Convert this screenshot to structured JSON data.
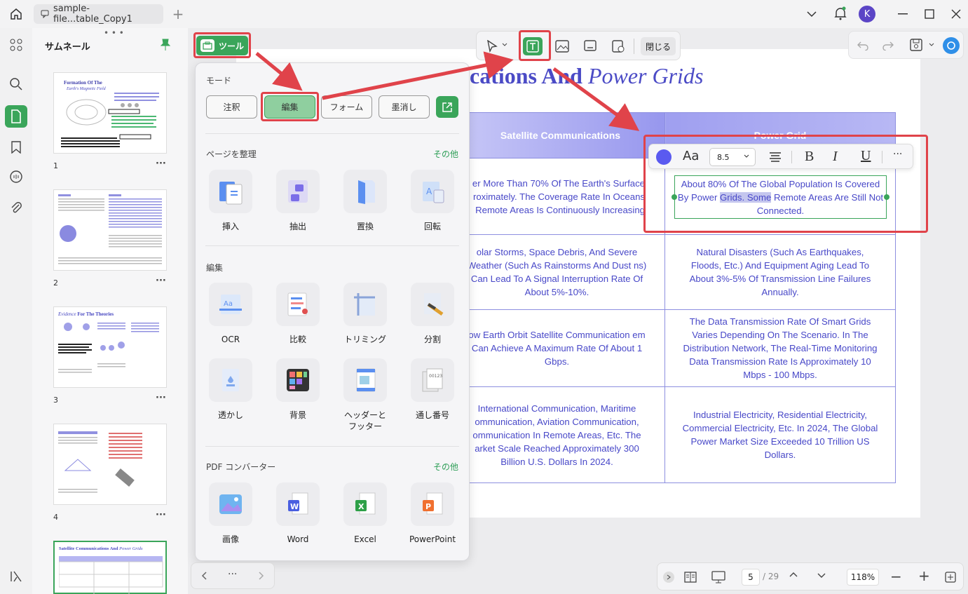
{
  "window": {
    "tab_label": "sample-file...table_Copy1",
    "user_initial": "K"
  },
  "thumbnails": {
    "title": "サムネール",
    "pages": [
      {
        "num": "1",
        "title_plain": "Formation Of The",
        "title_em": "Earth's Magnetic Field"
      },
      {
        "num": "2"
      },
      {
        "num": "3",
        "title_em": "Evidence",
        "title_plain": "For The Theories"
      },
      {
        "num": "4"
      },
      {
        "num": "5",
        "title_plain": "Satellite Communications And",
        "title_em": "Power Grids"
      }
    ]
  },
  "tools_button": {
    "label": "ツール"
  },
  "toolbar": {
    "close_label": "閉じる"
  },
  "document": {
    "heading_plain": "cations And ",
    "heading_em": "Power Grids",
    "col1_header": "Satellite Communications",
    "col2_header": "Power Grid",
    "rows": [
      {
        "left": "er More Than 70% Of The Earth's Surface roximately. The Coverage Rate In Oceans Remote Areas Is Continuously Increasing",
        "right_a": "About 80% Of The Global Population Is Covered By Power ",
        "right_sel": "Grids. Some",
        "right_b": " Remote Areas Are Still Not Connected."
      },
      {
        "left": "olar Storms, Space Debris, And Severe Weather (Such As Rainstorms And Dust ns) Can Lead To A Signal Interruption Rate Of About 5%-10%.",
        "right": "Natural Disasters (Such As Earthquakes, Floods, Etc.) And Equipment Aging Lead To About 3%-5% Of Transmission Line Failures Annually."
      },
      {
        "left": "ow Earth Orbit Satellite Communication em Can Achieve A Maximum Rate Of About 1 Gbps.",
        "right": "The Data Transmission Rate Of Smart Grids Varies Depending On The Scenario. In The Distribution Network, The Real-Time Monitoring Data Transmission Rate Is Approximately 10 Mbps - 100 Mbps."
      },
      {
        "left": "International Communication, Maritime ommunication, Aviation Communication, ommunication In Remote Areas, Etc. The arket Scale Reached Approximately 300 Billion U.S. Dollars In 2024.",
        "right": "Industrial Electricity, Residential Electricity, Commercial Electricity, Etc. In 2024, The Global Power Market Size Exceeded 10 Trillion US Dollars."
      }
    ]
  },
  "format_bar": {
    "font_label": "Aa",
    "size": "8.5",
    "bold": "B",
    "italic": "I",
    "underline": "U",
    "more": "···",
    "color": "#5a5af0"
  },
  "tool_panel": {
    "mode_title": "モード",
    "modes": [
      "注釈",
      "編集",
      "フォーム",
      "墨消し"
    ],
    "organize_title": "ページを整理",
    "organize_more": "その他",
    "organize_items": [
      "挿入",
      "抽出",
      "置換",
      "回転"
    ],
    "edit_title": "編集",
    "edit_items": [
      "OCR",
      "比較",
      "トリミング",
      "分割",
      "透かし",
      "背景",
      "ヘッダーと\nフッター",
      "通し番号"
    ],
    "converter_title": "PDF コンバーター",
    "converter_more": "その他",
    "converter_items": [
      "画像",
      "Word",
      "Excel",
      "PowerPoint"
    ]
  },
  "pagination": {
    "current": "5",
    "total": "/ 29",
    "zoom": "118%"
  },
  "colors": {
    "accent_green": "#3aa55a",
    "highlight_red": "#e0434a",
    "doc_blue": "#4848c8",
    "header_purple": "#8c8cf0"
  }
}
